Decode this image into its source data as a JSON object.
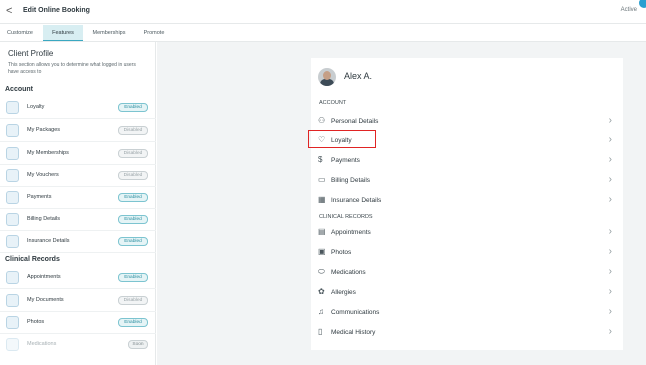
{
  "header": {
    "title": "Edit Online Booking",
    "back_glyph": "<",
    "status": "Active"
  },
  "tabs": [
    {
      "label": "Customize",
      "active": false
    },
    {
      "label": "Features",
      "active": true
    },
    {
      "label": "Memberships",
      "active": false
    },
    {
      "label": "Promote",
      "active": false
    }
  ],
  "left_panel": {
    "title": "Client Profile",
    "description": "This section allows you to determine what logged in users have access to",
    "account_heading": "Account",
    "account_items": [
      {
        "label": "Loyalty",
        "status": "Enabled",
        "status_type": "enabled",
        "icon": "heart-icon"
      },
      {
        "label": "My Packages",
        "status": "Disabled",
        "status_type": "disabled",
        "icon": "package-icon"
      },
      {
        "label": "My Memberships",
        "status": "Disabled",
        "status_type": "disabled",
        "icon": "membership-icon"
      },
      {
        "label": "My Vouchers",
        "status": "Disabled",
        "status_type": "disabled",
        "icon": "voucher-icon"
      },
      {
        "label": "Payments",
        "status": "Enabled",
        "status_type": "enabled",
        "icon": "dollar-icon"
      },
      {
        "label": "Billing Details",
        "status": "Enabled",
        "status_type": "enabled",
        "icon": "card-icon"
      },
      {
        "label": "Insurance Details",
        "status": "Enabled",
        "status_type": "enabled",
        "icon": "building-icon"
      }
    ],
    "clinical_heading": "Clinical Records",
    "clinical_items": [
      {
        "label": "Appointments",
        "status": "Enabled",
        "status_type": "enabled",
        "icon": "calendar-icon"
      },
      {
        "label": "My Documents",
        "status": "Disabled",
        "status_type": "disabled",
        "icon": "document-icon"
      },
      {
        "label": "Photos",
        "status": "Enabled",
        "status_type": "enabled",
        "icon": "photo-icon"
      },
      {
        "label": "Medications",
        "status": "Soon",
        "status_type": "soon",
        "icon": "pill-icon"
      }
    ]
  },
  "preview": {
    "user_name": "Alex A.",
    "account_label": "ACCOUNT",
    "account_rows": [
      {
        "label": "Personal Details",
        "icon": "user-icon",
        "glyph": "⚇"
      },
      {
        "label": "Loyalty",
        "icon": "heart-icon",
        "glyph": "♡"
      },
      {
        "label": "Payments",
        "icon": "dollar-icon",
        "glyph": "$"
      },
      {
        "label": "Billing Details",
        "icon": "card-icon",
        "glyph": "▭"
      },
      {
        "label": "Insurance Details",
        "icon": "building-icon",
        "glyph": "▦"
      }
    ],
    "clinical_label": "CLINICAL RECORDS",
    "clinical_rows": [
      {
        "label": "Appointments",
        "icon": "calendar-icon",
        "glyph": "▤"
      },
      {
        "label": "Photos",
        "icon": "photo-icon",
        "glyph": "▣"
      },
      {
        "label": "Medications",
        "icon": "pill-icon",
        "glyph": "⬭"
      },
      {
        "label": "Allergies",
        "icon": "allergy-icon",
        "glyph": "✿"
      },
      {
        "label": "Communications",
        "icon": "bell-icon",
        "glyph": "♫"
      },
      {
        "label": "Medical History",
        "icon": "history-icon",
        "glyph": "▯"
      }
    ],
    "chevron_glyph": "›"
  },
  "colors": {
    "accent": "#3aa8c1",
    "highlight": "#e02424",
    "panel_bg": "#f2f4f5"
  }
}
